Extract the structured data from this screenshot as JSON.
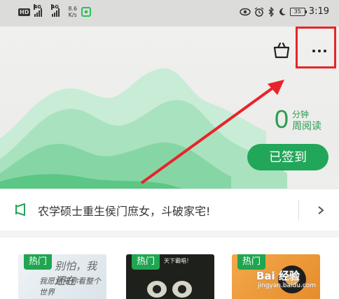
{
  "status_bar": {
    "network_badge": "HD",
    "signal1_gen": "4G",
    "signal2_gen": "4G",
    "speed_value": "8.6",
    "speed_unit": "K/s",
    "battery": "35",
    "time": "3:19"
  },
  "header": {
    "reading_minutes": "0",
    "unit_label": "分钟",
    "period_label": "周阅读",
    "signin_label": "已签到"
  },
  "notice": {
    "text": "农学硕士重生侯门庶女，斗破家宅!"
  },
  "books": [
    {
      "badge": "热门",
      "cover_text": "别怕，我还在",
      "cover_subtext": "我愿意陪你看整个世界"
    },
    {
      "badge": "热门",
      "cover_text": "天下霸唱！"
    },
    {
      "badge": "热门"
    }
  ],
  "watermark": {
    "brand": "Bai 经验",
    "url": "jingyan.baidu.com"
  },
  "colors": {
    "accent_green": "#22a659",
    "highlight_red": "#e8242a"
  }
}
